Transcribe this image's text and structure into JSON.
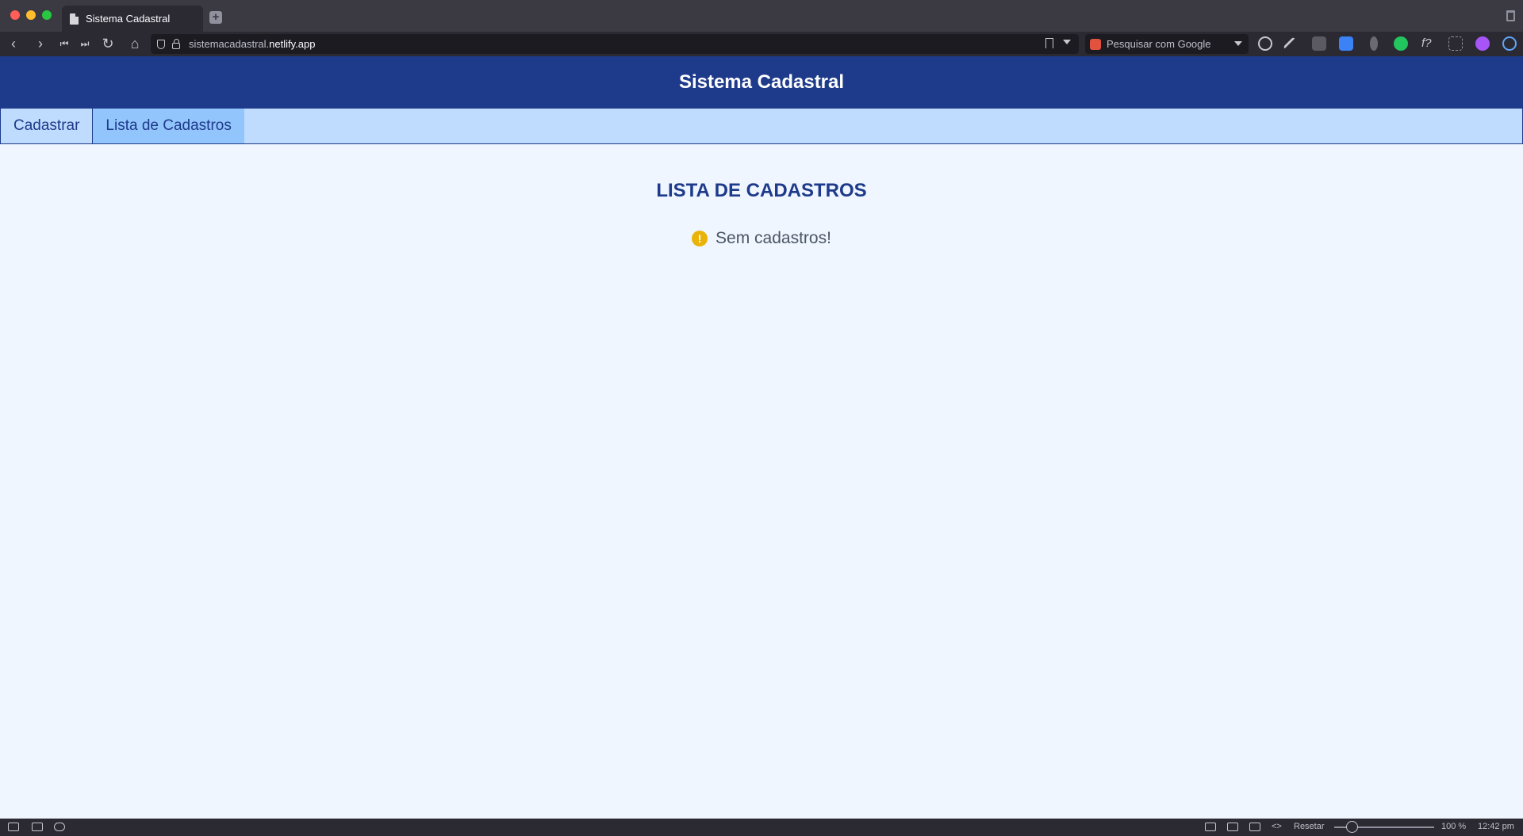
{
  "browser": {
    "tab_title": "Sistema Cadastral",
    "url_host": "sistemacadastral.",
    "url_domain": "netlify.app",
    "search_placeholder": "Pesquisar com Google"
  },
  "app": {
    "title": "Sistema Cadastral",
    "nav": [
      {
        "label": "Cadastrar"
      },
      {
        "label": "Lista de Cadastros"
      }
    ],
    "heading": "LISTA DE CADASTROS",
    "empty_message": "Sem cadastros!"
  },
  "statusbar": {
    "reset_label": "Resetar",
    "zoom": "100 %",
    "time": "12:42 pm"
  },
  "colors": {
    "header": "#1e3a8a",
    "nav_bg": "#bfdbfe",
    "nav_active": "#93c5fd",
    "page_bg": "#eff6ff",
    "warning": "#eab308"
  }
}
